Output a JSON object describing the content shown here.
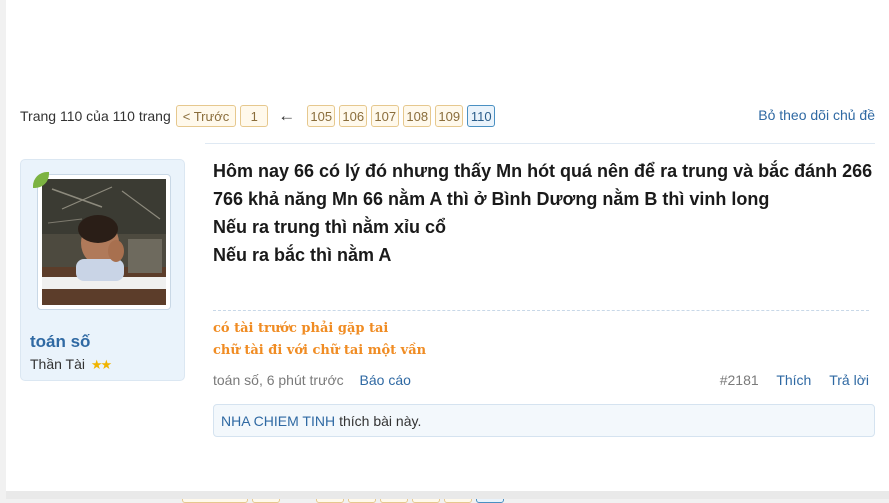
{
  "page_nav": {
    "label": "Trang 110 của 110 trang",
    "prev": "< Trước",
    "first": "1",
    "arrow": "←",
    "pages": [
      "105",
      "106",
      "107",
      "108",
      "109",
      "110"
    ],
    "current_page": "110"
  },
  "unwatch_label": "Bỏ theo dõi chủ đề",
  "post": {
    "user": {
      "name": "toán số",
      "title": "Thần Tài",
      "stars": "★★"
    },
    "message_lines": [
      "Hôm nay 66 có lý đó nhưng thấy Mn hót quá nên để ra trung và bắc đánh 266 766 khả năng Mn 66 nằm A thì ở Bình Dương nằm B thì vinh long",
      "Nếu ra trung thì nằm xỉu cổ",
      "Nếu ra bắc thì nằm A"
    ],
    "signature_lines": [
      "có tài trước phải gặp tai",
      "chữ tài đi với chữ tai một vần"
    ],
    "meta": {
      "author": "toán số",
      "time": ", 6 phút trước",
      "report": "Báo cáo"
    },
    "actions": {
      "post_number": "#2181",
      "like": "Thích",
      "reply": "Trả lời"
    },
    "likes": {
      "liker": "NHA CHIEM TINH",
      "text": "thích bài này."
    }
  },
  "colors": {
    "link": "#2f69a3",
    "signature": "#f08c23",
    "page_button_border": "#e6c88e",
    "current_page_border": "#4a90c2"
  }
}
